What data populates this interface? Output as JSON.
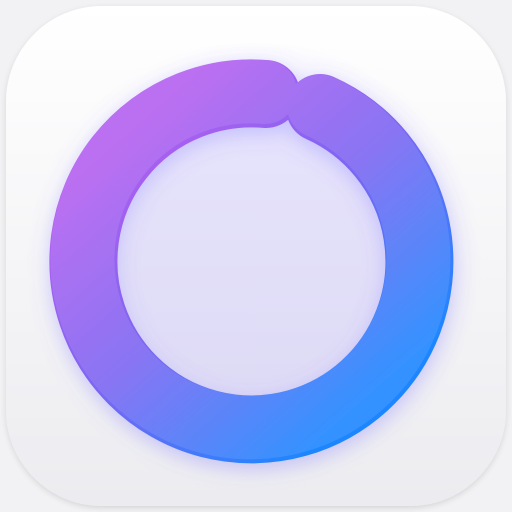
{
  "app_icon": {
    "icon": "ring-progress-icon",
    "colors": {
      "tile_top": "#ffffff",
      "tile_bottom": "#ececf0",
      "ring_start": "#b45ff0",
      "ring_mid": "#7a66f2",
      "ring_end": "#1f86ff",
      "background": "#f2f2f4"
    }
  }
}
